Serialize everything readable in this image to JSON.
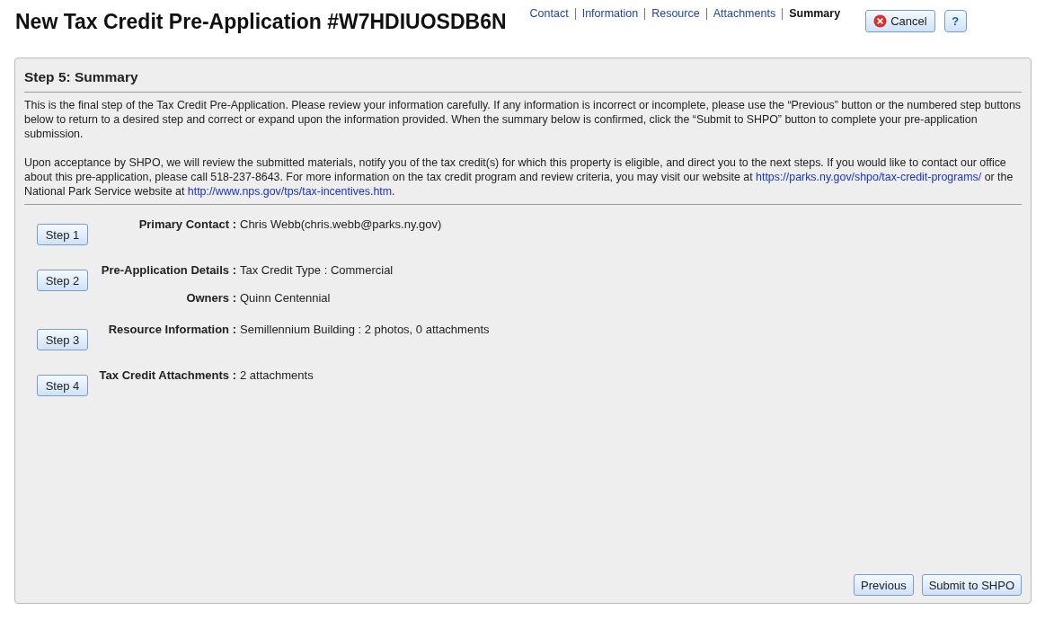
{
  "title": "New Tax Credit Pre-Application #W7HDIUOSDB6N",
  "nav": [
    {
      "label": "Contact",
      "selected": false
    },
    {
      "label": "Information",
      "selected": false
    },
    {
      "label": "Resource",
      "selected": false
    },
    {
      "label": "Attachments",
      "selected": false
    },
    {
      "label": "Summary",
      "selected": true
    }
  ],
  "cancel_button": "Cancel",
  "help_button": "?",
  "panel": {
    "heading": "Step 5: Summary",
    "paragraphs": [
      [
        {
          "kind": "text",
          "text": "This is the final step of the Tax Credit Pre-Application. Please review your information carefully. If any information is incorrect or incomplete, please use the “Previous” button or the numbered step buttons below to return to a desired step and correct or expand upon the information provided. When the summary below is confirmed, click the “Submit to SHPO” button to complete your pre-application submission."
        }
      ],
      [
        {
          "kind": "text",
          "text": "Upon acceptance by SHPO, we will review the submitted materials, notify you of the tax credit(s) for which this property is eligible, and direct you to the next steps. If you would like to contact our office about this pre-application, please call 518-237-8643. For more information on the tax credit program and review criteria, you may visit our website at "
        },
        {
          "kind": "link",
          "text": "https://parks.ny.gov/shpo/tax-credit-programs/"
        },
        {
          "kind": "text",
          "text": " or the National Park Service website at "
        },
        {
          "kind": "link",
          "text": "http://www.nps.gov/tps/tax-incentives.htm"
        },
        {
          "kind": "text",
          "text": "."
        }
      ]
    ],
    "steps": [
      {
        "button": "Step 1",
        "rows": [
          {
            "label": "Primary Contact :",
            "value": "Chris Webb(chris.webb@parks.ny.gov)"
          }
        ]
      },
      {
        "button": "Step 2",
        "rows": [
          {
            "label": "Pre-Application Details :",
            "value": "Tax Credit Type : Commercial"
          },
          {
            "label": "Owners :",
            "value": "Quinn Centennial"
          }
        ]
      },
      {
        "button": "Step 3",
        "rows": [
          {
            "label": "Resource Information :",
            "value": "Semillennium Building : 2 photos, 0 attachments"
          }
        ]
      },
      {
        "button": "Step 4",
        "rows": [
          {
            "label": "Tax Credit Attachments :",
            "value": "2 attachments"
          }
        ]
      }
    ],
    "buttons": [
      "Previous",
      "Submit to SHPO"
    ]
  }
}
